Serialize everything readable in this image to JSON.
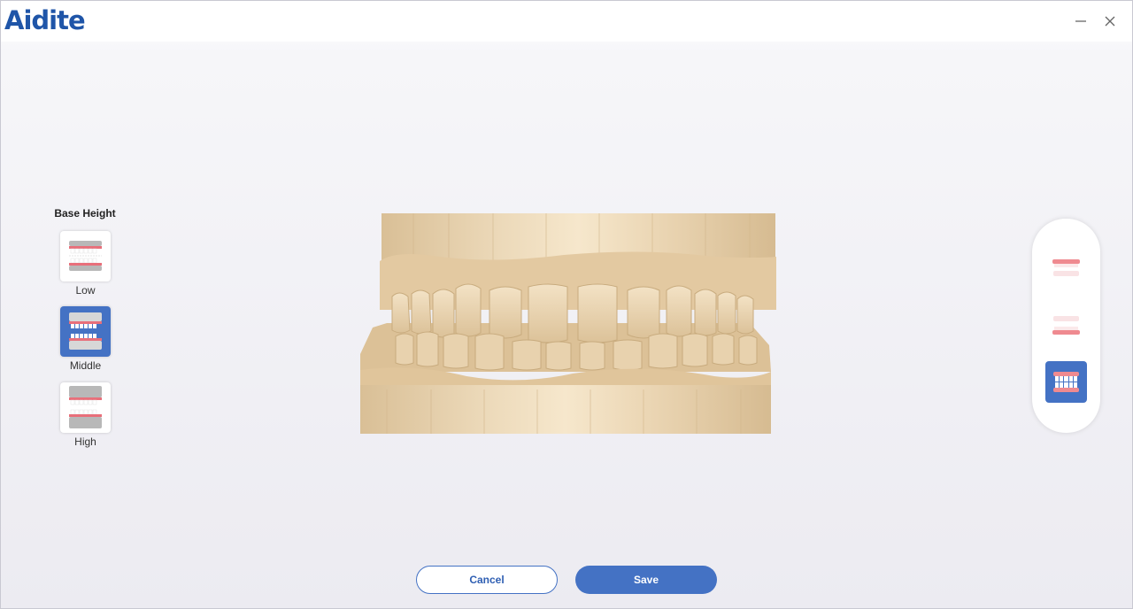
{
  "app": {
    "logo_text": "Aidite",
    "brand_color": "#1f55a8",
    "accent_color": "#4472c4"
  },
  "window_controls": {
    "minimize_icon": "minimize-icon",
    "close_icon": "close-icon"
  },
  "base_height": {
    "title": "Base Height",
    "options": [
      {
        "label": "Low",
        "icon": "base-low-icon",
        "selected": false
      },
      {
        "label": "Middle",
        "icon": "base-middle-icon",
        "selected": true
      },
      {
        "label": "High",
        "icon": "base-high-icon",
        "selected": false
      }
    ]
  },
  "view_selector": {
    "items": [
      {
        "icon": "upper-jaw-icon",
        "selected": false
      },
      {
        "icon": "lower-jaw-icon",
        "selected": false
      },
      {
        "icon": "both-jaws-icon",
        "selected": true
      }
    ]
  },
  "model_view": {
    "icon": "dental-model-3d",
    "model_color": "#e5cda8"
  },
  "footer": {
    "cancel_label": "Cancel",
    "save_label": "Save"
  }
}
